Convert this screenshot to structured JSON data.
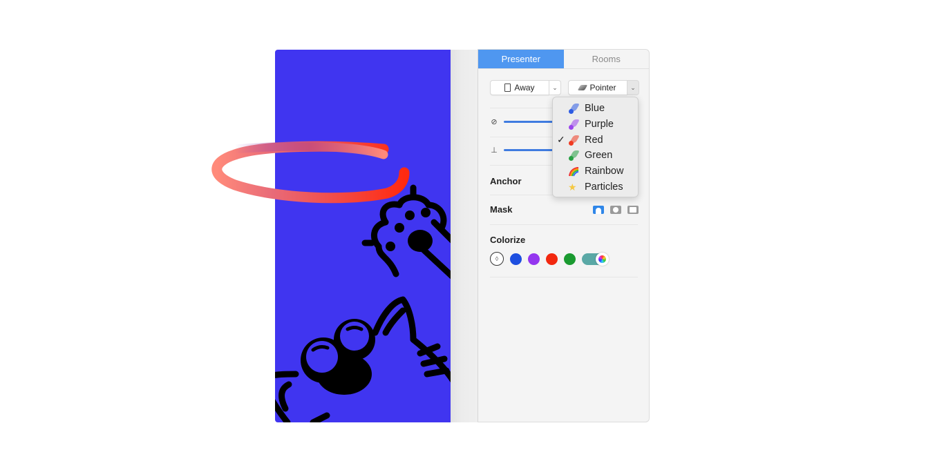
{
  "canvas": {
    "background_color": "#4035f0",
    "stroke_gradient": [
      "#ff8a7a",
      "#ff2a10"
    ],
    "illustration": "cartoon-cat-peeking-with-paw"
  },
  "panel": {
    "tabs": [
      {
        "label": "Presenter",
        "active": true
      },
      {
        "label": "Rooms",
        "active": false
      }
    ],
    "status_button": {
      "label": "Away",
      "icon": "door-icon"
    },
    "pointer_button": {
      "label": "Pointer",
      "icon": "brush-icon"
    },
    "sliders": [
      {
        "icon": "hidden-eye-icon",
        "value_percent": 100
      },
      {
        "icon": "stamp-icon",
        "value_percent": 100
      }
    ],
    "anchor_label": "Anchor",
    "mask_label": "Mask",
    "mask_options": [
      {
        "name": "person",
        "selected": true
      },
      {
        "name": "circle",
        "selected": false
      },
      {
        "name": "rectangle",
        "selected": false
      }
    ],
    "colorize_label": "Colorize",
    "colorize_swatches": [
      {
        "name": "none",
        "color": "#ffffff"
      },
      {
        "name": "blue",
        "color": "#1e4fe0"
      },
      {
        "name": "purple",
        "color": "#9436ef"
      },
      {
        "name": "red",
        "color": "#f2280f"
      },
      {
        "name": "green",
        "color": "#1a9a30"
      }
    ],
    "colorize_toggle": {
      "on": true,
      "color": "#5aa8a6"
    }
  },
  "pointer_menu": {
    "items": [
      {
        "label": "Blue",
        "color": "#2d5be3",
        "checked": false
      },
      {
        "label": "Purple",
        "color": "#9a45ec",
        "checked": false
      },
      {
        "label": "Red",
        "color": "#f03a22",
        "checked": true
      },
      {
        "label": "Green",
        "color": "#27a044",
        "checked": false
      },
      {
        "label": "Rainbow",
        "icon": "rainbow-icon",
        "checked": false
      },
      {
        "label": "Particles",
        "icon": "star-icon",
        "checked": false
      }
    ],
    "check_glyph": "✓"
  }
}
